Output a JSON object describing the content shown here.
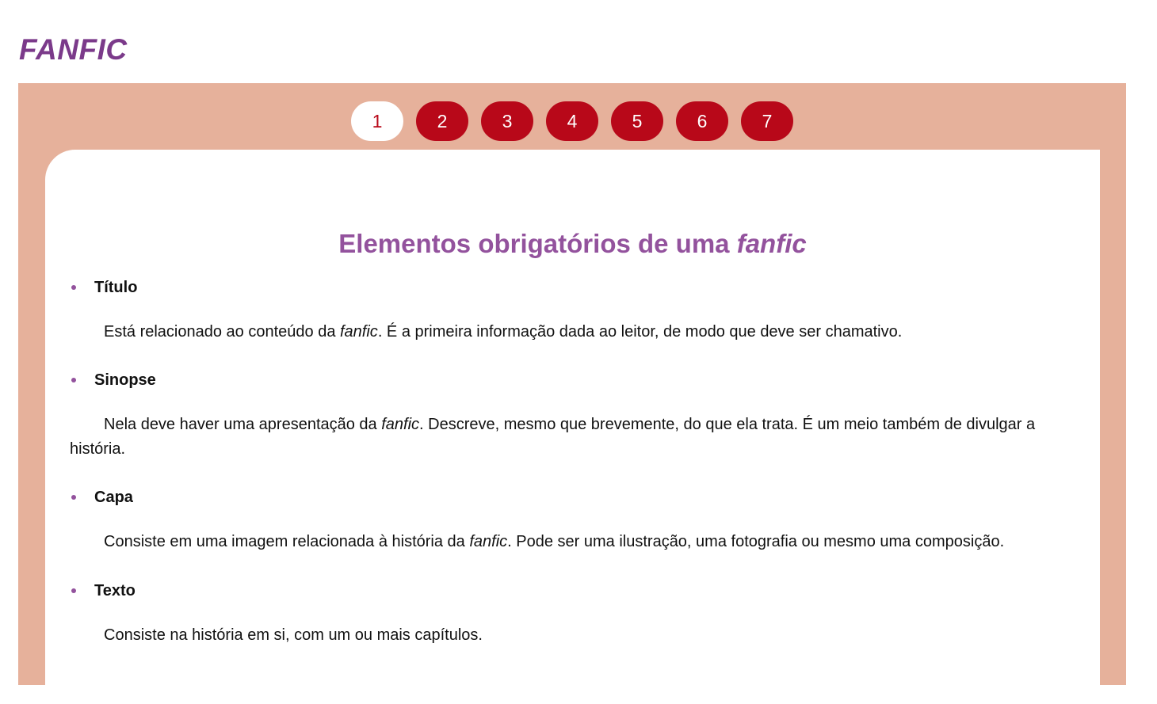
{
  "header": {
    "title": "FANFIC"
  },
  "pager": {
    "pages": [
      "1",
      "2",
      "3",
      "4",
      "5",
      "6",
      "7"
    ],
    "active": "1"
  },
  "content": {
    "heading_prefix": "Elementos obrigatórios de uma ",
    "heading_em": "fanfic",
    "items": [
      {
        "title": "Título",
        "desc_before": "Está relacionado ao conteúdo da ",
        "desc_em": "fanfic",
        "desc_after": ". É a primeira informação dada ao leitor, de modo que deve ser chamativo."
      },
      {
        "title": "Sinopse",
        "desc_before": "Nela deve haver uma apresentação da ",
        "desc_em": "fanfic",
        "desc_after": ". Descreve, mesmo que brevemente, do que ela trata. É um meio também de divulgar a história."
      },
      {
        "title": "Capa",
        "desc_before": "Consiste em uma imagem relacionada à história da ",
        "desc_em": "fanfic",
        "desc_after": ". Pode ser uma ilustração, uma fotografia ou mesmo uma composição."
      },
      {
        "title": "Texto",
        "desc_before": "Consiste na história em si, com um ou mais capítulos.",
        "desc_em": "",
        "desc_after": ""
      }
    ]
  },
  "colors": {
    "title": "#7b3a8a",
    "heading": "#93529d",
    "panel": "#e6b19b",
    "page_button": "#b80819"
  }
}
